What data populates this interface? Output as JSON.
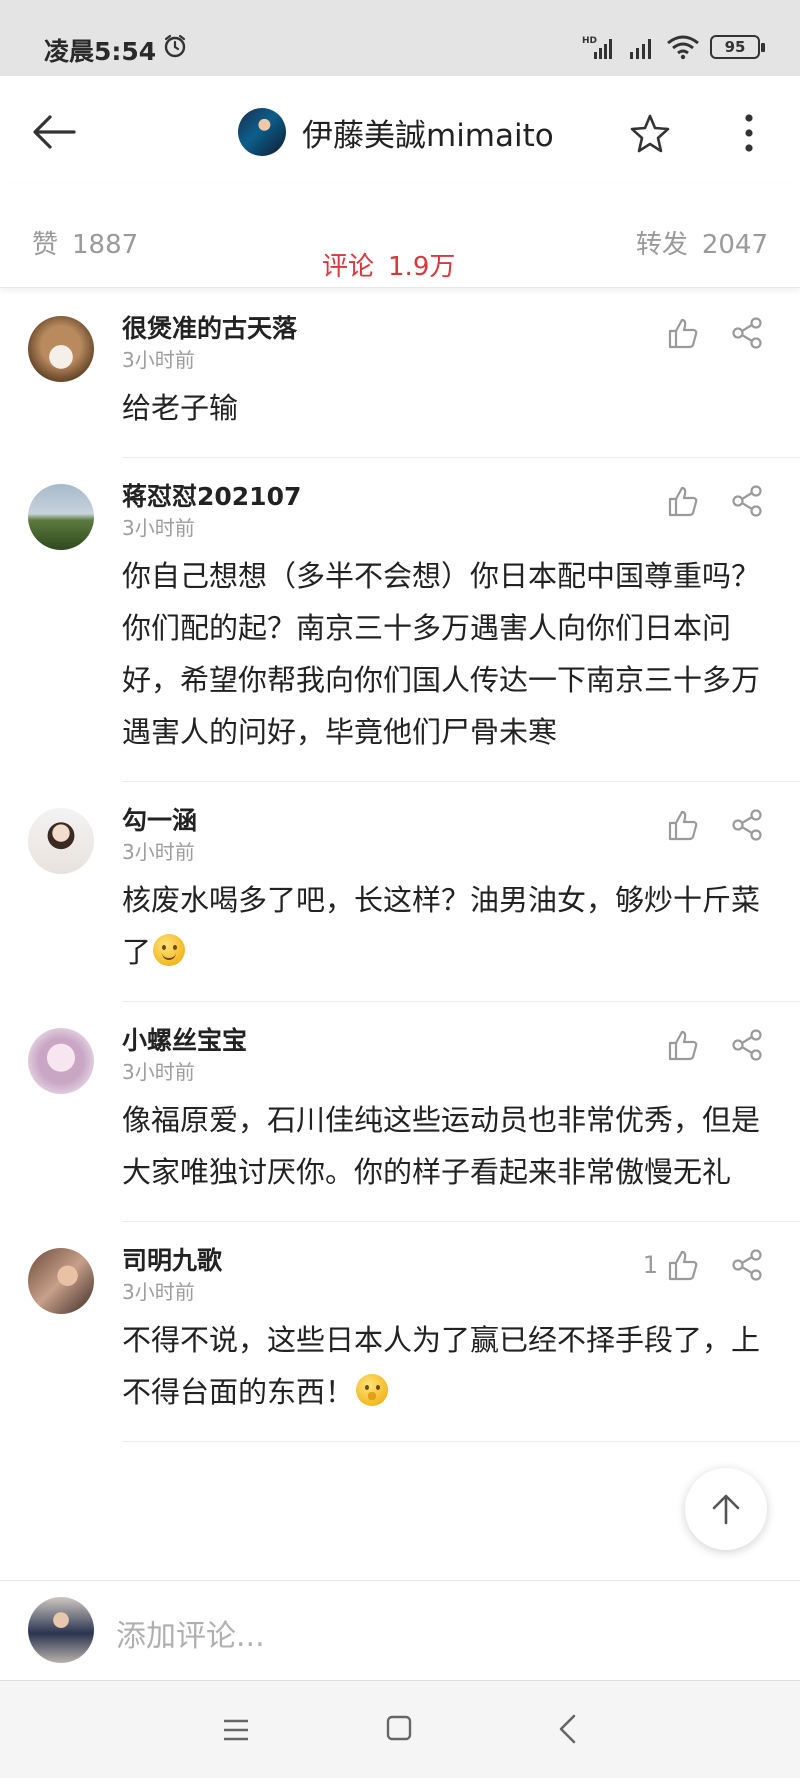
{
  "status_bar": {
    "time": "凌晨5:54",
    "battery": "95",
    "network_badge": "HD"
  },
  "header": {
    "title": "伊藤美誠mimaito"
  },
  "stats": {
    "like_label": "赞",
    "like_count": "1887",
    "comment_label": "评论",
    "comment_count": "1.9万",
    "repost_label": "转发",
    "repost_count": "2047",
    "active_tab": "评论"
  },
  "comments": [
    {
      "name": "很煲准的古天落",
      "time": "3小时前",
      "text": "给老子输",
      "likes": ""
    },
    {
      "name": "蒋怼怼202107",
      "time": "3小时前",
      "text": "你自己想想（多半不会想）你日本配中国尊重吗？你们配的起？南京三十多万遇害人向你们日本问好，希望你帮我向你们国人传达一下南京三十多万遇害人的问好，毕竟他们尸骨未寒",
      "likes": ""
    },
    {
      "name": "勾一涵",
      "time": "3小时前",
      "text": "核废水喝多了吧，长这样？油男油女，够炒十斤菜了",
      "emoji": "slightly-smiling-face",
      "likes": ""
    },
    {
      "name": "小螺丝宝宝",
      "time": "3小时前",
      "text": "像福原爱，石川佳纯这些运动员也非常优秀，但是大家唯独讨厌你。你的样子看起来非常傲慢无礼",
      "likes": ""
    },
    {
      "name": "司明九歌",
      "time": "3小时前",
      "text": "不得不说，这些日本人为了赢已经不择手段了，上不得台面的东西！",
      "emoji": "shushing-face",
      "likes": "1"
    }
  ],
  "composer": {
    "placeholder": "添加评论..."
  },
  "colors": {
    "accent": "#d8383b",
    "muted": "#9a9a9a",
    "status_bar_bg": "#e4e4e4"
  },
  "icons": [
    "back-arrow-icon",
    "star-icon",
    "more-vertical-icon",
    "thumb-up-icon",
    "share-icon",
    "arrow-up-icon",
    "menu-icon",
    "home-square-icon",
    "back-chevron-icon"
  ]
}
